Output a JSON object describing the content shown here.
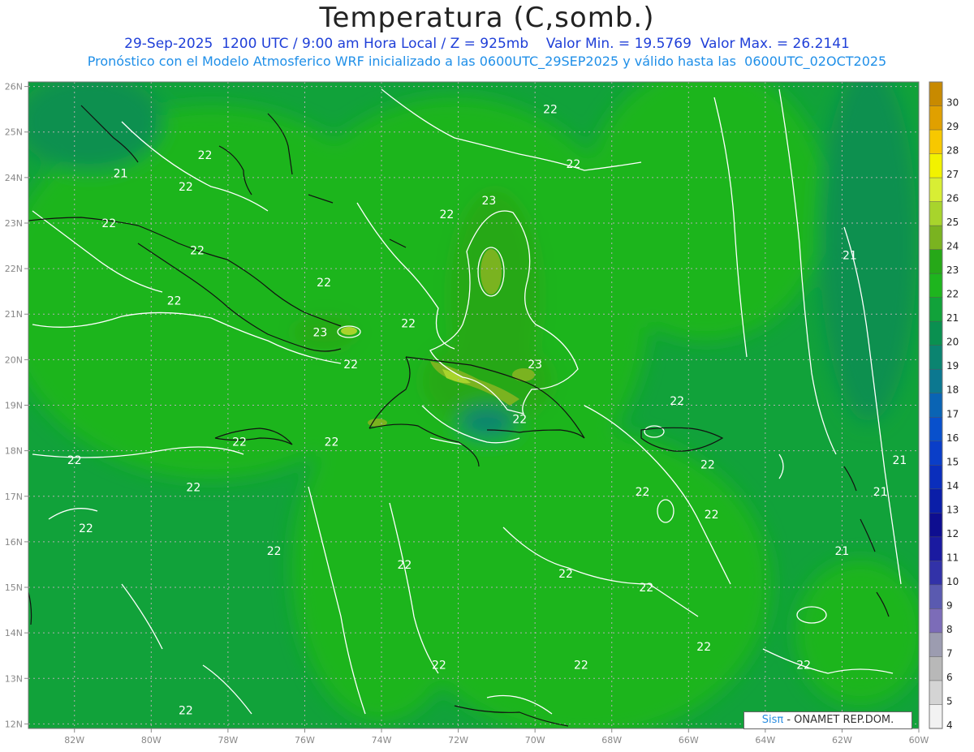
{
  "header": {
    "title": "Temperatura (C,somb.)",
    "line1": "29-Sep-2025  1200 UTC / 9:00 am Hora Local / Z = 925mb    Valor Min. = 19.5769  Valor Max. = 26.2141",
    "line2": "Pronóstico con el Modelo Atmosferico WRF inicializado a las 0600UTC_29SEP2025 y válido hasta las  0600UTC_02OCT2025"
  },
  "map": {
    "lon_labels": [
      "82W",
      "80W",
      "78W",
      "76W",
      "74W",
      "72W",
      "70W",
      "68W",
      "66W",
      "64W",
      "62W",
      "60W"
    ],
    "lat_labels": [
      "26N",
      "25N",
      "24N",
      "23N",
      "22N",
      "21N",
      "20N",
      "19N",
      "18N",
      "17N",
      "16N",
      "15N",
      "14N",
      "13N",
      "12N"
    ],
    "contour_labels": [
      {
        "text": "22",
        "lon": -69.6,
        "lat": 25.5
      },
      {
        "text": "22",
        "lon": -78.6,
        "lat": 24.5
      },
      {
        "text": "21",
        "lon": -80.8,
        "lat": 24.1
      },
      {
        "text": "22",
        "lon": -69.0,
        "lat": 24.3
      },
      {
        "text": "22",
        "lon": -79.1,
        "lat": 23.8
      },
      {
        "text": "22",
        "lon": -81.1,
        "lat": 23.0
      },
      {
        "text": "22",
        "lon": -72.3,
        "lat": 23.2
      },
      {
        "text": "23",
        "lon": -71.2,
        "lat": 23.5
      },
      {
        "text": "22",
        "lon": -78.8,
        "lat": 22.4
      },
      {
        "text": "22",
        "lon": -79.4,
        "lat": 21.3
      },
      {
        "text": "22",
        "lon": -75.5,
        "lat": 21.7
      },
      {
        "text": "21",
        "lon": -61.8,
        "lat": 22.3
      },
      {
        "text": "23",
        "lon": -75.6,
        "lat": 20.6
      },
      {
        "text": "22",
        "lon": -73.3,
        "lat": 20.8
      },
      {
        "text": "22",
        "lon": -74.8,
        "lat": 19.9
      },
      {
        "text": "23",
        "lon": -70.0,
        "lat": 19.9
      },
      {
        "text": "22",
        "lon": -66.3,
        "lat": 19.1
      },
      {
        "text": "22",
        "lon": -70.4,
        "lat": 18.7
      },
      {
        "text": "22",
        "lon": -77.7,
        "lat": 18.2
      },
      {
        "text": "22",
        "lon": -75.3,
        "lat": 18.2
      },
      {
        "text": "22",
        "lon": -82.0,
        "lat": 17.8
      },
      {
        "text": "21",
        "lon": -60.5,
        "lat": 17.8
      },
      {
        "text": "22",
        "lon": -65.5,
        "lat": 17.7
      },
      {
        "text": "22",
        "lon": -78.9,
        "lat": 17.2
      },
      {
        "text": "22",
        "lon": -67.2,
        "lat": 17.1
      },
      {
        "text": "21",
        "lon": -61.0,
        "lat": 17.1
      },
      {
        "text": "22",
        "lon": -65.4,
        "lat": 16.6
      },
      {
        "text": "22",
        "lon": -81.7,
        "lat": 16.3
      },
      {
        "text": "22",
        "lon": -76.8,
        "lat": 15.8
      },
      {
        "text": "21",
        "lon": -62.0,
        "lat": 15.8
      },
      {
        "text": "22",
        "lon": -73.4,
        "lat": 15.5
      },
      {
        "text": "22",
        "lon": -69.2,
        "lat": 15.3
      },
      {
        "text": "22",
        "lon": -67.1,
        "lat": 15.0
      },
      {
        "text": "22",
        "lon": -65.6,
        "lat": 13.7
      },
      {
        "text": "22",
        "lon": -72.5,
        "lat": 13.3
      },
      {
        "text": "22",
        "lon": -68.8,
        "lat": 13.3
      },
      {
        "text": "22",
        "lon": -63.0,
        "lat": 13.3
      },
      {
        "text": "22",
        "lon": -79.1,
        "lat": 12.3
      }
    ]
  },
  "colorbar": {
    "labels": [
      "30",
      "29",
      "28",
      "27",
      "26",
      "25",
      "24",
      "23",
      "22",
      "21",
      "20",
      "19",
      "18",
      "17",
      "16",
      "15",
      "14",
      "13",
      "12",
      "11",
      "10",
      "9",
      "8",
      "7",
      "6",
      "5",
      "4"
    ],
    "colors": [
      "#c88a00",
      "#e0a000",
      "#f7c800",
      "#f2f200",
      "#d8ee34",
      "#a8d42c",
      "#7ab320",
      "#26a818",
      "#1eb51e",
      "#11a23a",
      "#0a9050",
      "#0b8470",
      "#0c7890",
      "#0a64b4",
      "#0850cc",
      "#0a3ec8",
      "#0a2ebc",
      "#0a1ea8",
      "#0e0e90",
      "#1a1aa0",
      "#3232a8",
      "#5a5ab0",
      "#7c6cb8",
      "#9c9cb0",
      "#b8b8b8",
      "#d4d4d4",
      "#f2f2f2"
    ]
  },
  "credit": {
    "brand": "Sisπ",
    "rest": " - ONAMET REP.DOM."
  }
}
